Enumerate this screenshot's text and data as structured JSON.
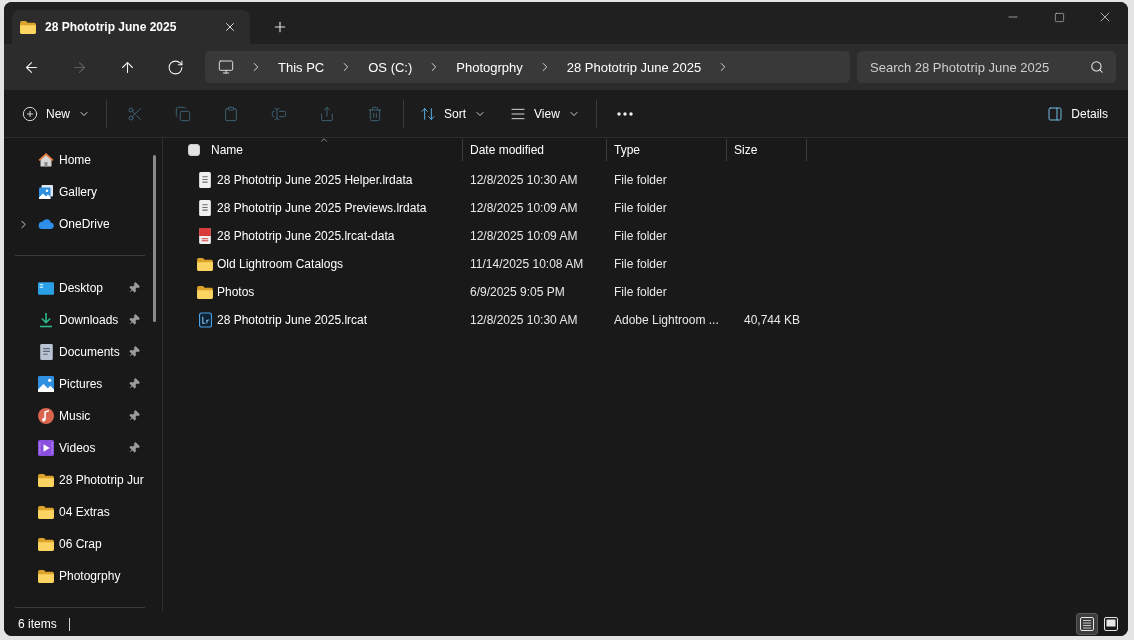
{
  "tabs": [
    {
      "title": "28 Phototrip June 2025",
      "selected": true
    }
  ],
  "navigation": {
    "buttons": [
      {
        "kind": "back",
        "disabled": false
      },
      {
        "kind": "forward",
        "disabled": true
      },
      {
        "kind": "up",
        "disabled": false
      },
      {
        "kind": "refresh",
        "disabled": false
      }
    ],
    "address_bar": {
      "segments": [
        "This PC",
        "OS (C:)",
        "Photogrphy",
        "28 Phototrip June 2025"
      ]
    },
    "search": {
      "placeholder": "Search 28 Phototrip June 2025"
    }
  },
  "toolbar": {
    "groups": [
      [
        {
          "kind": "new",
          "label": "New",
          "dropdown": true,
          "disabled": false
        }
      ],
      [
        {
          "kind": "cut",
          "dropdown": false,
          "disabled": true
        },
        {
          "kind": "copy",
          "dropdown": false,
          "disabled": true
        },
        {
          "kind": "paste",
          "dropdown": false,
          "disabled": true
        },
        {
          "kind": "rename",
          "dropdown": false,
          "disabled": true
        },
        {
          "kind": "share",
          "dropdown": false,
          "disabled": true
        },
        {
          "kind": "delete",
          "dropdown": false,
          "disabled": true
        }
      ],
      [
        {
          "kind": "sort",
          "label": "Sort",
          "dropdown": true,
          "disabled": false
        },
        {
          "kind": "view",
          "label": "View",
          "dropdown": true,
          "disabled": false
        }
      ],
      [
        {
          "kind": "more",
          "dropdown": false,
          "disabled": false
        }
      ]
    ],
    "details": {
      "label": "Details"
    }
  },
  "sidebar": {
    "groups": [
      [
        {
          "kind": "home",
          "label": "Home",
          "expandable": false,
          "pinned": false
        },
        {
          "kind": "gallery",
          "label": "Gallery",
          "expandable": false,
          "pinned": false
        },
        {
          "kind": "cloud",
          "label": "OneDrive",
          "expandable": true,
          "pinned": false
        }
      ],
      [
        {
          "kind": "desktop",
          "label": "Desktop",
          "expandable": false,
          "pinned": true
        },
        {
          "kind": "downloads",
          "label": "Downloads",
          "expandable": false,
          "pinned": true
        },
        {
          "kind": "documents",
          "label": "Documents",
          "expandable": false,
          "pinned": true
        },
        {
          "kind": "pictures",
          "label": "Pictures",
          "expandable": false,
          "pinned": true
        },
        {
          "kind": "music",
          "label": "Music",
          "expandable": false,
          "pinned": true
        },
        {
          "kind": "videos",
          "label": "Videos",
          "expandable": false,
          "pinned": true
        },
        {
          "kind": "folder",
          "label": "28 Phototrip Jur",
          "expandable": false,
          "pinned": false
        },
        {
          "kind": "folder",
          "label": "04 Extras",
          "expandable": false,
          "pinned": false
        },
        {
          "kind": "folder",
          "label": "06 Crap",
          "expandable": false,
          "pinned": false
        },
        {
          "kind": "folder",
          "label": "Photogrphy",
          "expandable": false,
          "pinned": false
        }
      ]
    ]
  },
  "file_list": {
    "select_all": {
      "checked": false
    },
    "columns": [
      {
        "label": "Name",
        "sorted": true
      },
      {
        "label": "Date modified",
        "sorted": false
      },
      {
        "label": "Type",
        "sorted": false
      },
      {
        "label": "Size",
        "sorted": false
      }
    ],
    "rows": [
      {
        "kind": "document",
        "name": "28 Phototrip June 2025 Helper.lrdata",
        "date_modified": "12/8/2025 10:30 AM",
        "type": "File folder"
      },
      {
        "kind": "document",
        "name": "28 Phototrip June 2025 Previews.lrdata",
        "date_modified": "12/8/2025 10:09 AM",
        "type": "File folder"
      },
      {
        "kind": "data",
        "name": "28 Phototrip June 2025.lrcat-data",
        "date_modified": "12/8/2025 10:09 AM",
        "type": "File folder"
      },
      {
        "kind": "folder",
        "name": "Old Lightroom Catalogs",
        "date_modified": "11/14/2025 10:08 AM",
        "type": "File folder"
      },
      {
        "kind": "folder",
        "name": "Photos",
        "date_modified": "6/9/2025 9:05 PM",
        "type": "File folder"
      },
      {
        "kind": "catalog",
        "name": "28 Phototrip June 2025.lrcat",
        "date_modified": "12/8/2025 10:30 AM",
        "type": "Adobe Lightroom ...",
        "size": "40,744 KB"
      }
    ]
  },
  "status_bar": {
    "item_count": "6 items",
    "views": [
      {
        "kind": "details",
        "selected": true
      },
      {
        "kind": "tiles",
        "selected": false
      }
    ]
  }
}
